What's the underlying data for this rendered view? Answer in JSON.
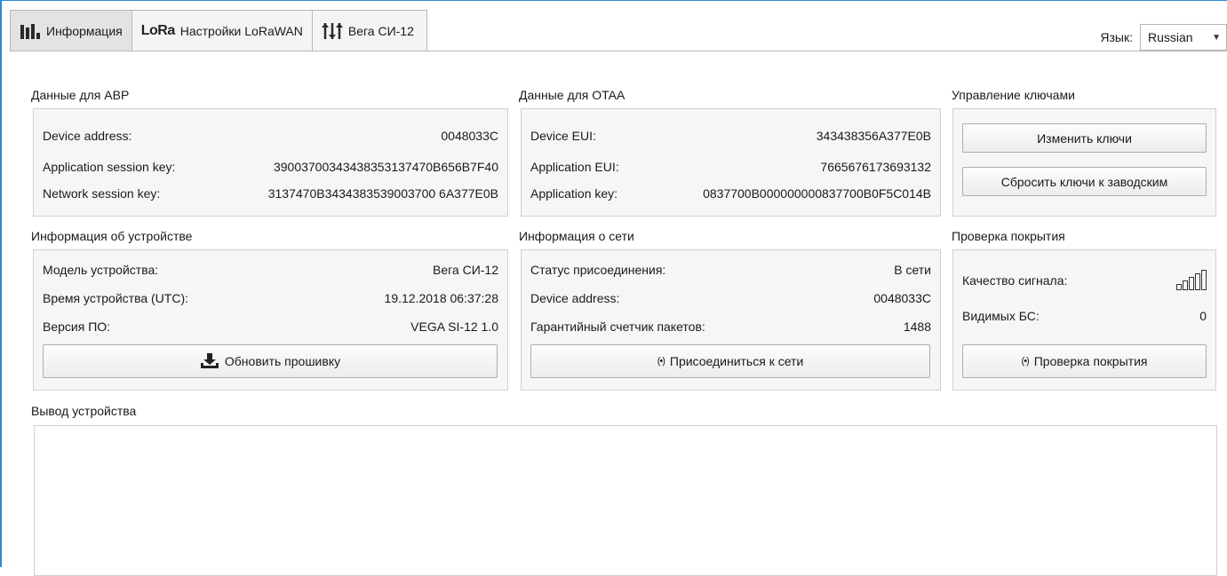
{
  "tabs": [
    {
      "label": "Информация",
      "active": true,
      "icon": "bar-chart-icon"
    },
    {
      "label": "Настройки LoRaWAN",
      "active": false,
      "icon": "lora-logo",
      "logo_text": "LoRa"
    },
    {
      "label": "Вега СИ-12",
      "active": false,
      "icon": "sliders-icon"
    }
  ],
  "language": {
    "label": "Язык:",
    "value": "Russian"
  },
  "abp": {
    "title": "Данные для ABP",
    "rows": [
      {
        "label": "Device address:",
        "value": "0048033C"
      },
      {
        "label": "Application session key:",
        "value": "39003700343438353137470B656B7F40"
      },
      {
        "label": "Network session key:",
        "value": "3137470B3434383539003700 6A377E0B"
      }
    ]
  },
  "otaa": {
    "title": "Данные для OTAA",
    "rows": [
      {
        "label": "Device EUI:",
        "value": "343438356A377E0B"
      },
      {
        "label": "Application EUI:",
        "value": "7665676173693132"
      },
      {
        "label": "Application key:",
        "value": "0837700B000000000837700B0F5C014B"
      }
    ]
  },
  "keys": {
    "title": "Управление ключами",
    "change_label": "Изменить ключи",
    "reset_label": "Сбросить ключи к заводским"
  },
  "device": {
    "title": "Информация об устройстве",
    "rows": [
      {
        "label": "Модель устройства:",
        "value": "Вега СИ-12"
      },
      {
        "label": "Время устройства (UTC):",
        "value": "19.12.2018 06:37:28"
      },
      {
        "label": "Версия ПО:",
        "value": "VEGA SI-12 1.0"
      }
    ],
    "update_label": "Обновить прошивку"
  },
  "network": {
    "title": "Информация о сети",
    "rows": [
      {
        "label": "Статус присоединения:",
        "value": "В сети"
      },
      {
        "label": "Device address:",
        "value": "0048033C"
      },
      {
        "label": "Гарантийный счетчик пакетов:",
        "value": "1488"
      }
    ],
    "join_label": "Присоединиться к сети",
    "join_icon_text": "(•)"
  },
  "coverage": {
    "title": "Проверка покрытия",
    "signal_label": "Качество сигнала:",
    "bs_label": "Видимых БС:",
    "bs_value": "0",
    "check_label": "Проверка покрытия",
    "check_icon_text": "(•)"
  },
  "output": {
    "title": "Вывод устройства"
  }
}
